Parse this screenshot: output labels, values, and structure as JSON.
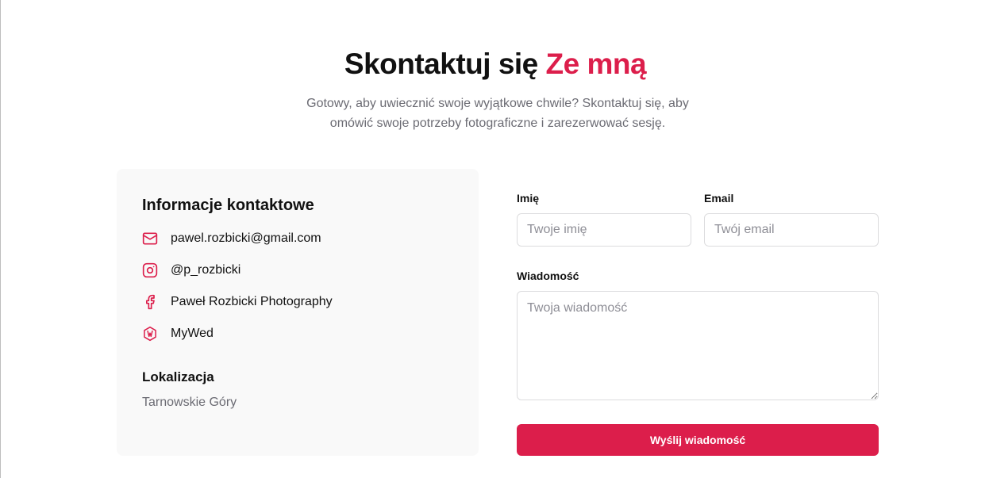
{
  "header": {
    "title_main": "Skontaktuj się",
    "title_accent": "Ze mną",
    "subtitle": "Gotowy, aby uwiecznić swoje wyjątkowe chwile? Skontaktuj się, aby omówić swoje potrzeby fotograficzne i zarezerwować sesję."
  },
  "info": {
    "title": "Informacje kontaktowe",
    "items": [
      {
        "icon": "mail-icon",
        "text": "pawel.rozbicki@gmail.com"
      },
      {
        "icon": "instagram-icon",
        "text": "@p_rozbicki"
      },
      {
        "icon": "facebook-icon",
        "text": "Paweł Rozbicki Photography"
      },
      {
        "icon": "mywed-icon",
        "text": "MyWed"
      }
    ],
    "location_label": "Lokalizacja",
    "location_value": "Tarnowskie Góry"
  },
  "form": {
    "name_label": "Imię",
    "name_placeholder": "Twoje imię",
    "name_value": "",
    "email_label": "Email",
    "email_placeholder": "Twój email",
    "email_value": "",
    "message_label": "Wiadomość",
    "message_placeholder": "Twoja wiadomość",
    "message_value": "",
    "submit_label": "Wyślij wiadomość"
  },
  "colors": {
    "accent": "#dc1e4b",
    "muted_text": "#6b6b73",
    "card_bg": "#f9f9f9"
  }
}
